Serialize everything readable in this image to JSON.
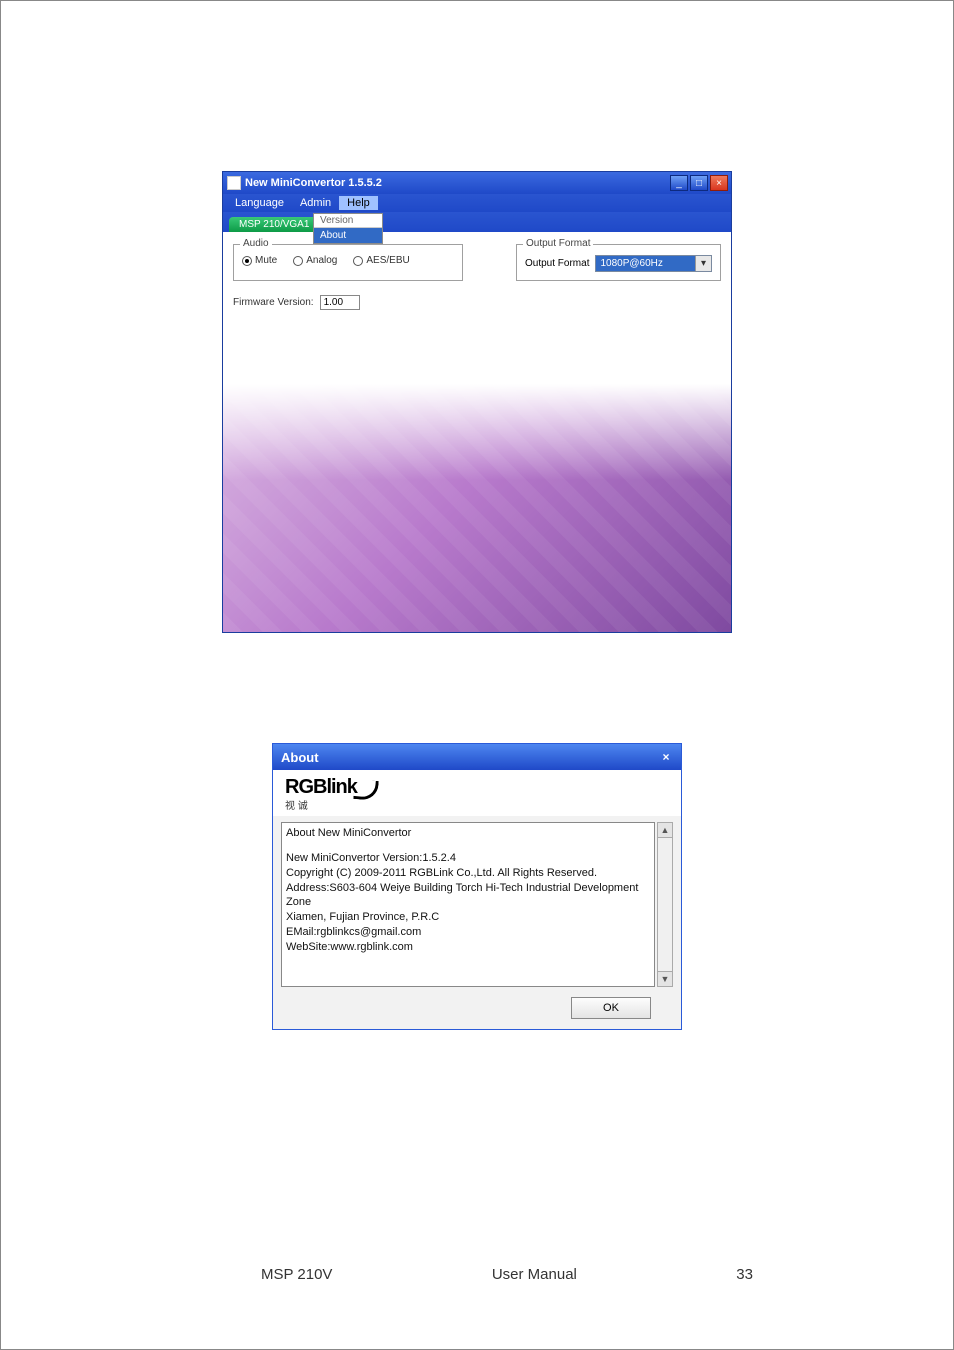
{
  "window": {
    "title": "New MiniConvertor 1.5.5.2",
    "minimize": "_",
    "maximize": "□",
    "close": "×"
  },
  "menu": {
    "language": "Language",
    "admin": "Admin",
    "help": "Help"
  },
  "help_dropdown": {
    "version": "Version",
    "about": "About"
  },
  "tabs": {
    "active": "MSP 210/VGA1"
  },
  "audio": {
    "legend": "Audio",
    "mute": "Mute",
    "analog": "Analog",
    "aesebu": "AES/EBU"
  },
  "output": {
    "legend": "Output Format",
    "label": "Output Format",
    "value": "1080P@60Hz"
  },
  "firmware": {
    "label": "Firmware Version:",
    "value": "1.00"
  },
  "about": {
    "title": "About",
    "close": "×",
    "logo_main": "RGBlink",
    "logo_sub": "视 诚",
    "line1": "About New MiniConvertor",
    "line2": "New MiniConvertor  Version:1.5.2.4",
    "line3": "Copyright (C) 2009-2011 RGBLink Co.,Ltd. All Rights Reserved.",
    "line4": "Address:S603-604 Weiye Building Torch Hi-Tech Industrial Development Zone",
    "line5": "Xiamen, Fujian Province, P.R.C",
    "line6": "EMail:rgblinkcs@gmail.com",
    "line7": "WebSite:www.rgblink.com",
    "ok": "OK",
    "scroll_up": "▲",
    "scroll_down": "▼"
  },
  "footer": {
    "left": "MSP 210V",
    "center": "User Manual",
    "right": "33"
  }
}
